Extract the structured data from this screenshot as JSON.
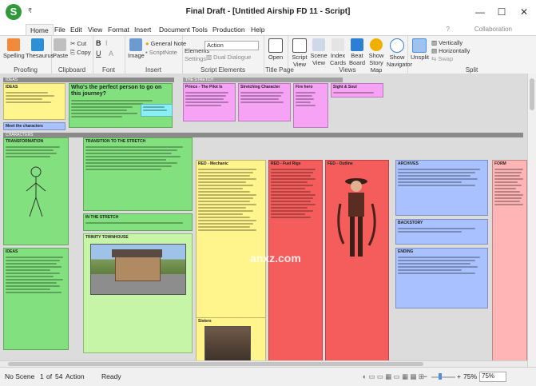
{
  "titlebar": {
    "logo": "S",
    "quick_access": "₹",
    "title": "Final Draft - [Untitled Airship FD 11 - Script]",
    "min": "—",
    "max": "☐",
    "close": "✕"
  },
  "menu": {
    "items": [
      "Home",
      "File",
      "Edit",
      "View",
      "Format",
      "Insert",
      "Document",
      "Tools",
      "Production",
      "Help"
    ],
    "help_icon": "?",
    "collaboration": "Collaboration"
  },
  "ribbon": {
    "proofing": {
      "label": "Proofing",
      "spelling": "Spelling",
      "thesaurus": "Thesaurus"
    },
    "clipboard": {
      "label": "Clipboard",
      "paste": "Paste",
      "cut": "Cut",
      "copy": "Copy"
    },
    "font": {
      "label": "Font",
      "bold": "B",
      "italic": "I",
      "underline": "U",
      "strike": "A"
    },
    "insert": {
      "label": "Insert",
      "image": "Image",
      "general_note": "General Note",
      "scriptnote": "ScriptNote"
    },
    "script_elements": {
      "label": "Script Elements",
      "elements": "Elements",
      "settings": "Settings",
      "element_value": "Action",
      "dual_dialogue": "Dual Dialogue"
    },
    "title_page": {
      "label": "Title Page",
      "open": "Open"
    },
    "views": {
      "label": "Views",
      "script": "Script",
      "view": "View",
      "scene": "Scene",
      "view2": "View",
      "index": "Index",
      "cards": "Cards",
      "beat": "Beat",
      "board": "Board",
      "show_story": "Show Story",
      "map": "Map",
      "show": "Show",
      "navigator": "Navigator"
    },
    "split": {
      "label": "Split",
      "unsplit": "Unsplit",
      "vertically": "Vertically",
      "horizontally": "Horizontally",
      "swap": "Swap"
    }
  },
  "board": {
    "watermark": "anxz.com",
    "band1": "IDEAS",
    "band2": "CHARACTERS",
    "card_main_title": "Who's the perfect person to go on this journey?",
    "card_meet": "Meet the characters",
    "card_stretch": "THE STRETCH",
    "card_pilot": "Prince - The Pilot Is",
    "card_stretched": "Stretching Character",
    "card_fire": "Fire hero",
    "card_sight": "Sight & Soul",
    "card_dream": "FORM",
    "card_trans": "TRANSFORMATION",
    "card_trans2": "TRANSITION TO THE STRETCH",
    "card_stretch2": "IN THE STRETCH",
    "card_townhouse": "TRINITY TOWNHOUSE",
    "card_ideas": "IDEAS",
    "card_sisters": "Sisters",
    "card_red": "RED - Mechanic",
    "card_rigs": "RED - Fuel Rigs",
    "card_fed": "FED - Outline",
    "card_backstory": "BACKSTORY",
    "card_ending": "ENDING",
    "card_blue": "ARCHIVES"
  },
  "status": {
    "scene": "No Scene",
    "page_num": "1",
    "page_of": "of",
    "page_total": "54",
    "element": "Action",
    "state": "Ready",
    "zoom1": "75%",
    "zoom2": "75%"
  },
  "colors": {
    "accent": "#4a90d9",
    "logo_green": "#2f9a3a",
    "workspace": "#dcdcdc"
  }
}
